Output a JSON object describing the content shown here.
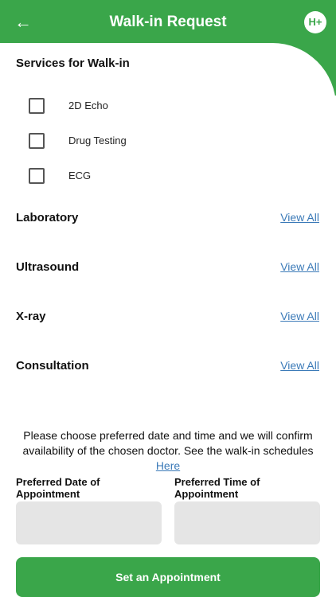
{
  "header": {
    "title": "Walk-in Request",
    "back_icon": "arrow-left-icon",
    "logo_text": "H+",
    "color": "#3aa64a"
  },
  "services": {
    "title": "Services for Walk-in",
    "items": [
      {
        "label": "2D Echo",
        "checked": false
      },
      {
        "label": "Drug Testing",
        "checked": false
      },
      {
        "label": "ECG",
        "checked": false
      }
    ]
  },
  "categories": [
    {
      "label": "Laboratory",
      "action": "View All"
    },
    {
      "label": "Ultrasound",
      "action": "View All"
    },
    {
      "label": "X-ray",
      "action": "View All"
    },
    {
      "label": "Consultation",
      "action": "View All"
    }
  ],
  "notice": {
    "text": "Please choose preferred date and time and we will confirm availability of the chosen doctor. See the walk-in schedules ",
    "link": "Here"
  },
  "form": {
    "date_label": "Preferred Date of Appointment",
    "time_label": "Preferred Time of Appointment",
    "date_value": "",
    "time_value": ""
  },
  "submit_label": "Set an Appointment",
  "link_color": "#3b7ab8"
}
